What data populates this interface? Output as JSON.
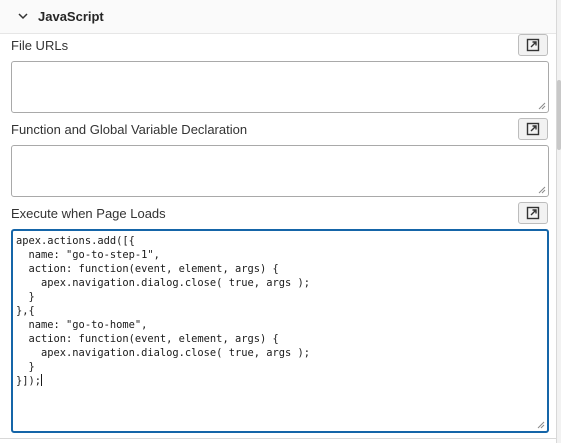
{
  "section": {
    "title": "JavaScript",
    "expanded": true,
    "toggle_icon": "chevron-down-icon"
  },
  "fields": {
    "file_urls": {
      "label": "File URLs",
      "value": "",
      "expand_icon": "popout-icon"
    },
    "declarations": {
      "label": "Function and Global Variable Declaration",
      "value": "",
      "expand_icon": "popout-icon"
    },
    "page_load": {
      "label": "Execute when Page Loads",
      "value": "apex.actions.add([{\n  name: \"go-to-step-1\",\n  action: function(event, element, args) {\n    apex.navigation.dialog.close( true, args );\n  }\n},{\n  name: \"go-to-home\",\n  action: function(event, element, args) {\n    apex.navigation.dialog.close( true, args );\n  }\n}]);",
      "expand_icon": "popout-icon",
      "focused": true
    }
  },
  "colors": {
    "focus_border": "#1565a8",
    "border": "#a9a9a9",
    "label_text": "#333333"
  }
}
